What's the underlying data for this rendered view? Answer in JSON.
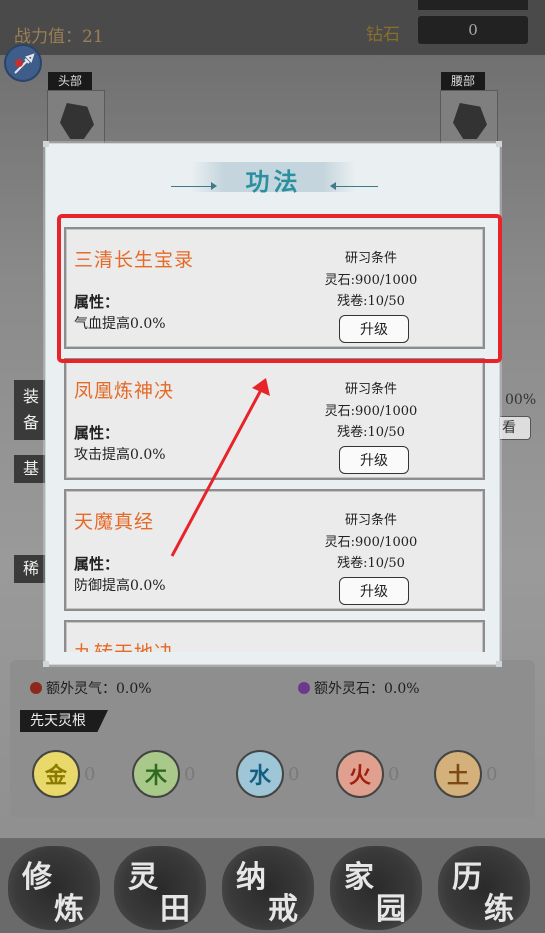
{
  "header": {
    "power_label": "战力值：21",
    "diamond_label": "钻石",
    "diamond_value": "0"
  },
  "equipment": {
    "slot_head_label": "头部",
    "slot_waist_label": "腰部"
  },
  "left_tabs": {
    "tab1_char1": "装",
    "tab1_char2": "备",
    "tab2_char1": "基",
    "tab3_char1": "稀"
  },
  "right_fragments": {
    "percent_frag": "00%",
    "view_frag": "看"
  },
  "modal": {
    "title": "功法",
    "cards": [
      {
        "name": "三清长生宝录",
        "attr_title": "属性：",
        "attr_value": "气血提高0.0%",
        "req_title": "研习条件",
        "req_stone": "灵石:900/1000",
        "req_scroll": "残卷:10/50",
        "button": "升级"
      },
      {
        "name": "凤凰炼神决",
        "attr_title": "属性：",
        "attr_value": "攻击提高0.0%",
        "req_title": "研习条件",
        "req_stone": "灵石:900/1000",
        "req_scroll": "残卷:10/50",
        "button": "升级"
      },
      {
        "name": "天魔真经",
        "attr_title": "属性：",
        "attr_value": "防御提高0.0%",
        "req_title": "研习条件",
        "req_stone": "灵石:900/1000",
        "req_scroll": "残卷:10/50",
        "button": "升级"
      },
      {
        "name": "九转天地决"
      }
    ]
  },
  "stats": {
    "extra_qi": "额外灵气：0.0%",
    "extra_stone": "额外灵石：0.0%"
  },
  "innate_root": {
    "label": "先天灵根",
    "items": [
      {
        "glyph": "金",
        "value": "0",
        "color": "#c9b400"
      },
      {
        "glyph": "木",
        "value": "0",
        "color": "#3a8a2a"
      },
      {
        "glyph": "水",
        "value": "0",
        "color": "#1e7fa8"
      },
      {
        "glyph": "火",
        "value": "0",
        "color": "#b22a1a"
      },
      {
        "glyph": "土",
        "value": "0",
        "color": "#8a5a1e"
      }
    ]
  },
  "bottom_nav": [
    {
      "c1": "修",
      "c2": "炼"
    },
    {
      "c1": "灵",
      "c2": "田"
    },
    {
      "c1": "纳",
      "c2": "戒"
    },
    {
      "c1": "家",
      "c2": "园"
    },
    {
      "c1": "历",
      "c2": "练"
    }
  ],
  "colors": {
    "card_name": "#e66a27",
    "title": "#2a8fa0",
    "highlight": "#e8242b"
  }
}
